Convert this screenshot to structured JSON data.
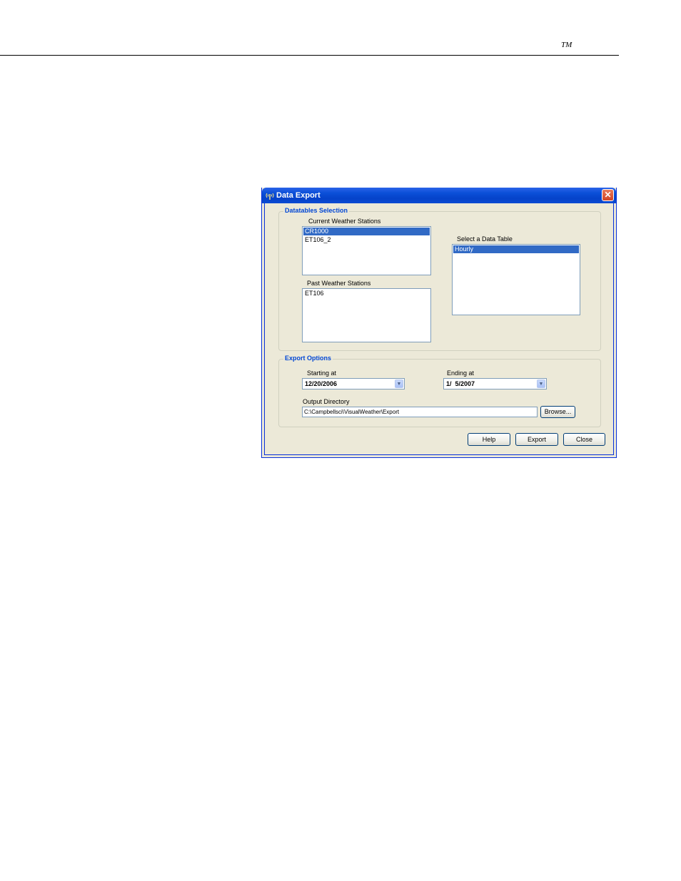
{
  "page": {
    "trademark": "TM"
  },
  "dialog": {
    "title": "Data Export",
    "title_icon": "antenna-icon",
    "close_glyph": "✕",
    "datatables": {
      "group_label": "Datatables Selection",
      "current_label": "Current Weather Stations",
      "current_items": [
        "CR1000",
        "ET106_2"
      ],
      "current_selected": "CR1000",
      "past_label": "Past Weather Stations",
      "past_items": [
        "ET106"
      ],
      "table_label": "Select a Data Table",
      "table_items": [
        "Hourly"
      ],
      "table_selected": "Hourly"
    },
    "export_options": {
      "group_label": "Export Options",
      "starting_label": "Starting at",
      "starting_value": "12/20/2006",
      "ending_label": "Ending at",
      "ending_value": "1/  5/2007",
      "output_label": "Output Directory",
      "output_value": "C:\\Campbellsci\\VisualWeather\\Export",
      "browse_label": "Browse..."
    },
    "buttons": {
      "help": "Help",
      "export": "Export",
      "close": "Close"
    }
  }
}
